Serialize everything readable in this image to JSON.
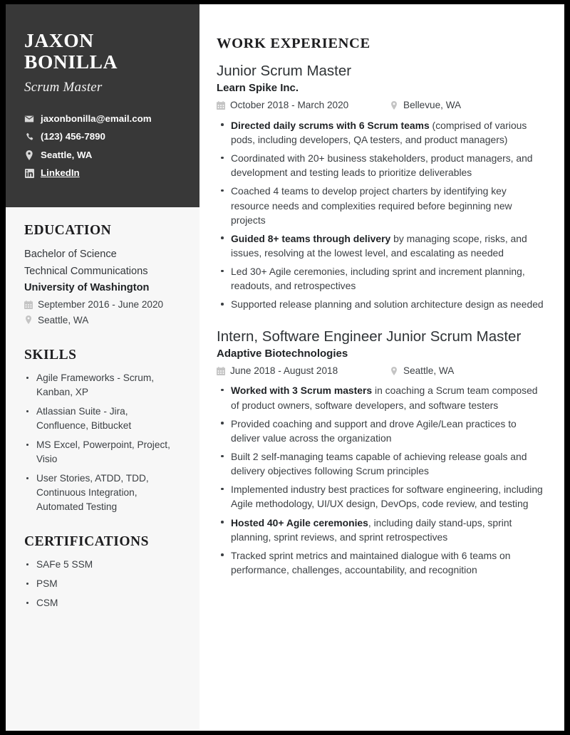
{
  "sidebar": {
    "name": "JAXON BONILLA",
    "role": "Scrum Master",
    "contacts": [
      {
        "icon": "envelope-icon",
        "text": "jaxonbonilla@email.com",
        "link": false
      },
      {
        "icon": "phone-icon",
        "text": "(123) 456-7890",
        "link": false
      },
      {
        "icon": "map-pin-icon",
        "text": "Seattle, WA",
        "link": false
      },
      {
        "icon": "linkedin-icon",
        "text": "LinkedIn",
        "link": true
      }
    ],
    "education": {
      "heading": "EDUCATION",
      "degree": "Bachelor of Science",
      "field": "Technical Communications",
      "school": "University of Washington",
      "dates": "September 2016 - June 2020",
      "location": "Seattle, WA"
    },
    "skills": {
      "heading": "SKILLS",
      "items": [
        "Agile Frameworks - Scrum, Kanban, XP",
        "Atlassian Suite - Jira, Confluence, Bitbucket",
        "MS Excel, Powerpoint, Project, Visio",
        "User Stories, ATDD, TDD, Continuous Integration, Automated Testing"
      ]
    },
    "certifications": {
      "heading": "CERTIFICATIONS",
      "items": [
        "SAFe 5 SSM",
        "PSM",
        "CSM"
      ]
    }
  },
  "main": {
    "heading": "WORK EXPERIENCE",
    "jobs": [
      {
        "title": "Junior Scrum Master",
        "company": "Learn Spike Inc.",
        "dates": "October 2018 - March 2020",
        "location": "Bellevue, WA",
        "bullets": [
          {
            "bold": "Directed daily scrums with 6 Scrum teams",
            "rest": " (comprised of various pods, including developers, QA testers, and product managers)"
          },
          {
            "bold": "",
            "rest": "Coordinated with 20+ business stakeholders, product managers, and development and testing leads to prioritize deliverables"
          },
          {
            "bold": "",
            "rest": "Coached 4 teams to develop project charters by identifying key resource needs and complexities required before beginning new projects"
          },
          {
            "bold": "Guided 8+ teams through delivery",
            "rest": " by managing scope, risks, and issues, resolving at the lowest level, and escalating as needed"
          },
          {
            "bold": "",
            "rest": "Led 30+ Agile ceremonies, including sprint and increment planning, readouts, and retrospectives"
          },
          {
            "bold": "",
            "rest": "Supported release planning and solution architecture design as needed"
          }
        ]
      },
      {
        "title": "Intern, Software Engineer Junior Scrum Master",
        "company": "Adaptive Biotechnologies",
        "dates": "June 2018 - August 2018",
        "location": "Seattle, WA",
        "bullets": [
          {
            "bold": "Worked with 3 Scrum masters",
            "rest": " in coaching a Scrum team composed of product owners, software developers, and software testers"
          },
          {
            "bold": "",
            "rest": "Provided coaching and support and drove Agile/Lean practices to deliver value across the organization"
          },
          {
            "bold": "",
            "rest": "Built 2 self-managing teams capable of achieving release goals and delivery objectives following Scrum principles"
          },
          {
            "bold": "",
            "rest": "Implemented industry best practices for software engineering, including Agile methodology, UI/UX design, DevOps, code review, and testing"
          },
          {
            "bold": "Hosted 40+ Agile ceremonies",
            "rest": ", including daily stand-ups, sprint planning, sprint reviews, and sprint retrospectives"
          },
          {
            "bold": "",
            "rest": "Tracked sprint metrics and maintained dialogue with 6 teams on performance, challenges, accountability, and recognition"
          }
        ]
      }
    ]
  },
  "colors": {
    "page_border": "#000000",
    "header_block": "#383838",
    "sidebar_bg": "#f7f7f7",
    "main_bg": "#ffffff",
    "heading": "#1d1d1f",
    "body_text": "#3b3f43",
    "icon_muted": "#c4c4c4"
  }
}
